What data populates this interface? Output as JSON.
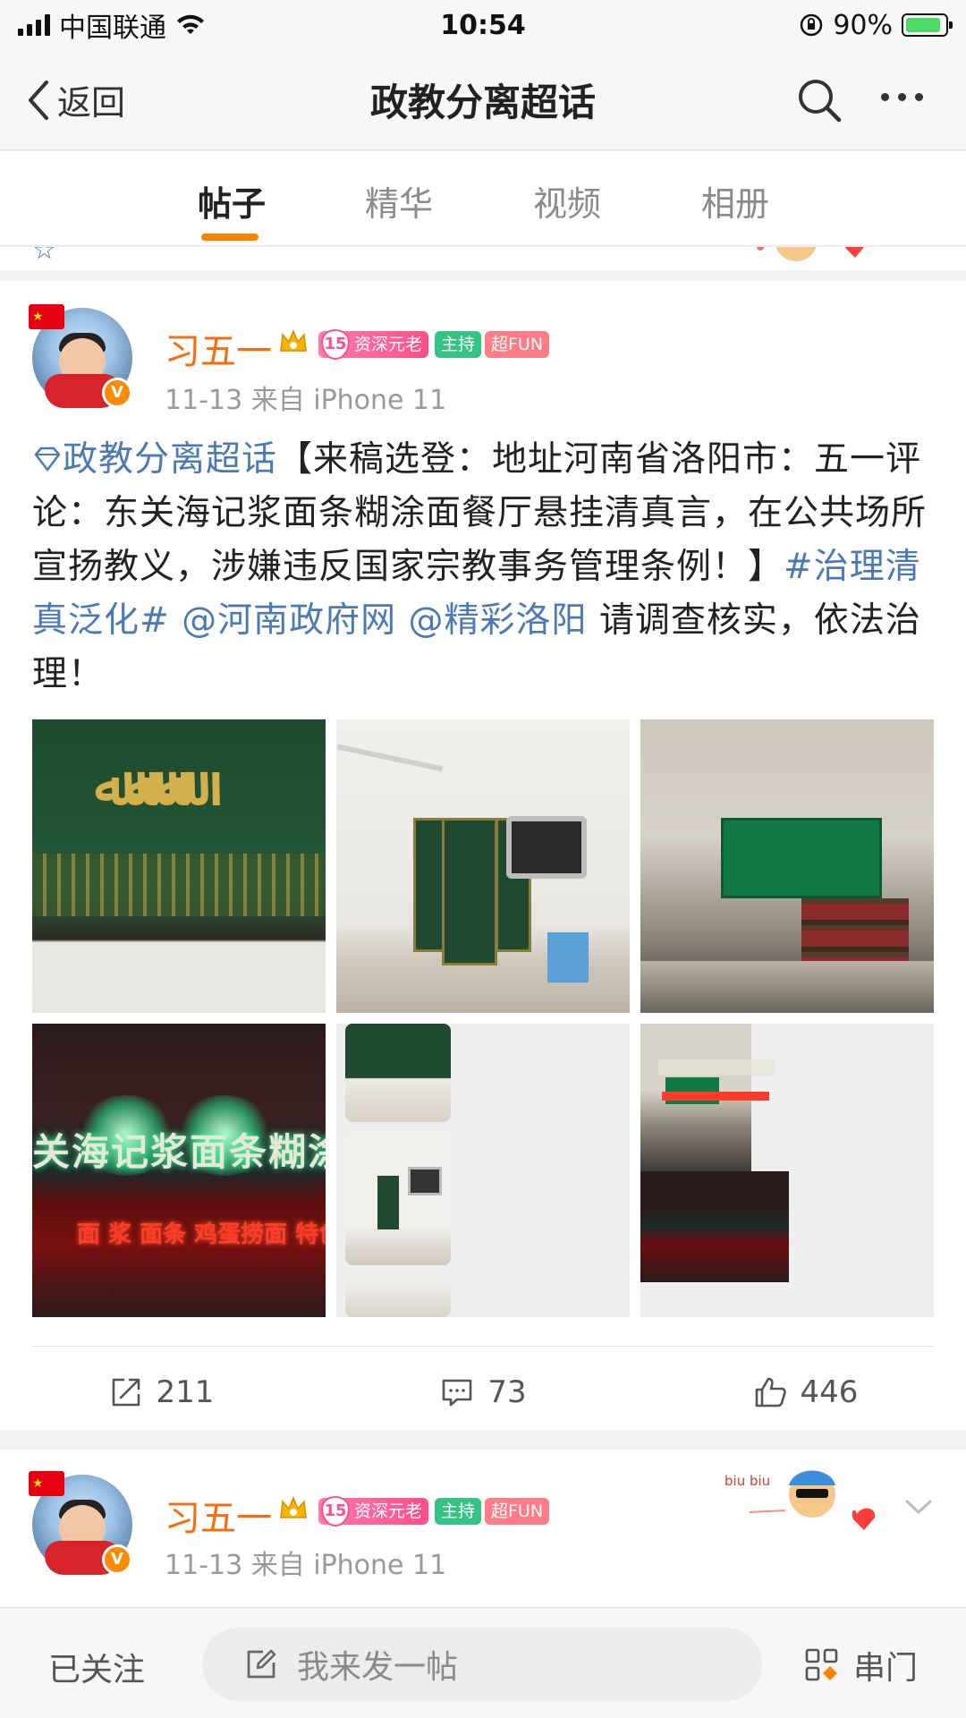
{
  "status_bar": {
    "carrier": "中国联通",
    "time": "10:54",
    "battery": "90%"
  },
  "nav": {
    "back_label": "返回",
    "title": "政教分离超话"
  },
  "tabs": [
    {
      "label": "帖子",
      "active": true
    },
    {
      "label": "精华",
      "active": false
    },
    {
      "label": "视频",
      "active": false
    },
    {
      "label": "相册",
      "active": false
    }
  ],
  "post1": {
    "username": "习五一",
    "badges": {
      "level": "15",
      "veteran": "资深元老",
      "host": "主持",
      "fun": "超FUN"
    },
    "meta": "11-13  来自 iPhone 11",
    "topic_link": "政教分离超话",
    "text_1": "【来稿选登：地址河南省洛阳市：五一评论：东关海记浆面条糊涂面餐厅悬挂清真言，在公共场所宣扬教义，涉嫌违反国家宗教事务管理条例！】",
    "hashtag": "#治理清真泛化#",
    "mention_1": "@河南政府网",
    "mention_2": "@精彩洛阳",
    "text_2": " 请调查核实，依法治理！",
    "photo_sign": "关海记浆面条糊涂面",
    "photo_led": "面 浆 面条 鸡蛋捞面 特色",
    "reposts": "211",
    "comments": "73",
    "likes": "446"
  },
  "post2": {
    "username": "习五一",
    "badges": {
      "level": "15",
      "veteran": "资深元老",
      "host": "主持",
      "fun": "超FUN"
    },
    "meta": "11-13  来自 iPhone 11",
    "deco_text": "biu biu"
  },
  "bottom_bar": {
    "follow_label": "已关注",
    "compose_placeholder": "我来发一帖",
    "chuanmen_label": "串门"
  },
  "colors": {
    "accent": "#ff8200",
    "link": "#4a7ab5",
    "username": "#f86c0d"
  }
}
